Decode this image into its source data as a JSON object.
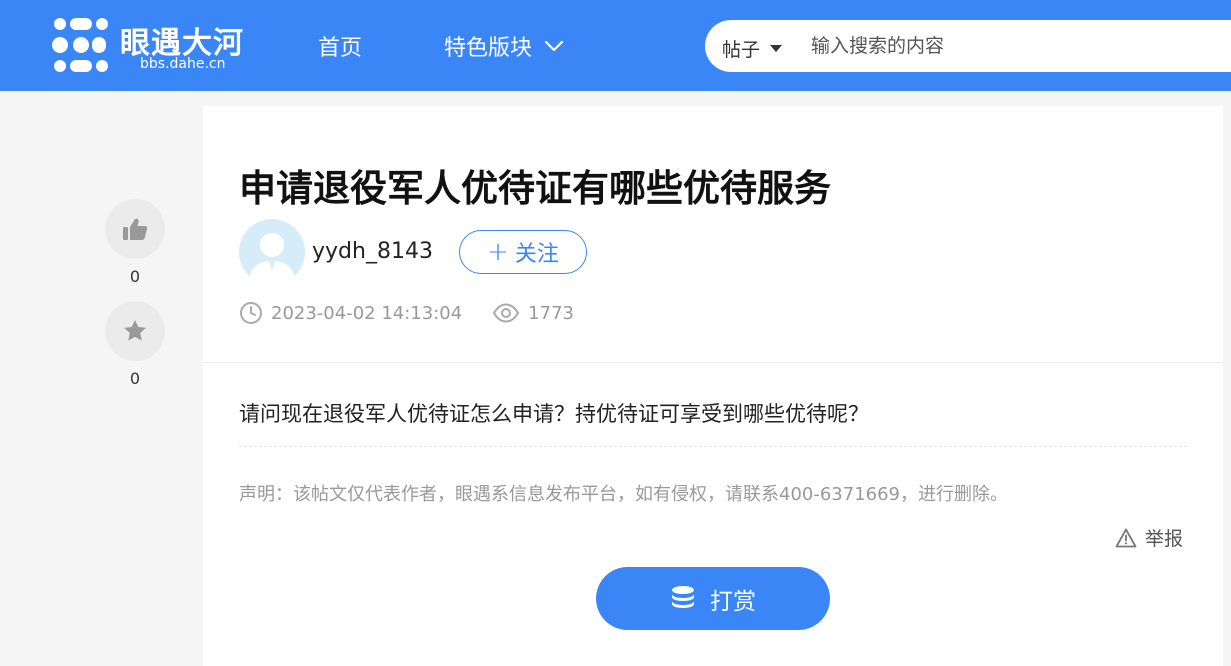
{
  "header": {
    "logo_text": "眼遇大河",
    "logo_sub": "bbs.dahe.cn",
    "nav": {
      "home": "首页",
      "featured": "特色版块"
    },
    "search": {
      "type_label": "帖子",
      "placeholder": "输入搜索的内容"
    }
  },
  "sidebar": {
    "like_count": "0",
    "favorite_count": "0"
  },
  "post": {
    "title": "申请退役军人优待证有哪些优待服务",
    "author": "yydh_8143",
    "follow_label": "关注",
    "follow_plus": "+",
    "timestamp": "2023-04-02 14:13:04",
    "views": "1773",
    "content": "请问现在退役军人优待证怎么申请？持优待证可享受到哪些优待呢？",
    "notice": "声明：该帖文仅代表作者，眼遇系信息发布平台，如有侵权，请联系400-6371669，进行删除。",
    "report_label": "举报",
    "reward_label": "打赏"
  },
  "colors": {
    "brand": "#3a86f7",
    "page_bg": "#f5f5f5",
    "muted_text": "#999999"
  }
}
